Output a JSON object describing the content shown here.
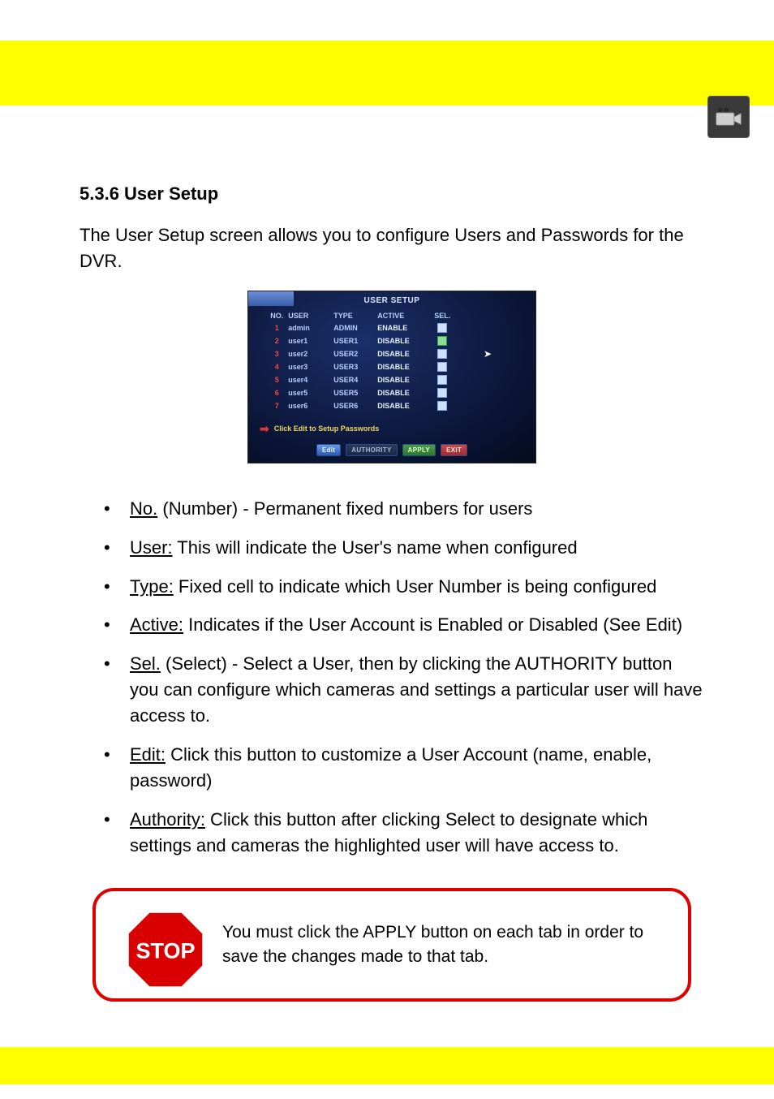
{
  "header": {
    "icon_name": "camera-icon"
  },
  "section": {
    "title": "5.3.6 User Setup",
    "intro": "The User Setup screen allows you to configure Users and Passwords for the DVR."
  },
  "dvr": {
    "title": "USER SETUP",
    "headers": {
      "no": "NO.",
      "user": "USER",
      "type": "TYPE",
      "active": "ACTIVE",
      "sel": "SEL."
    },
    "rows": [
      {
        "no": "1",
        "user": "admin",
        "type": "ADMIN",
        "active": "ENABLE",
        "sel": false
      },
      {
        "no": "2",
        "user": "user1",
        "type": "USER1",
        "active": "DISABLE",
        "sel": true
      },
      {
        "no": "3",
        "user": "user2",
        "type": "USER2",
        "active": "DISABLE",
        "sel": false
      },
      {
        "no": "4",
        "user": "user3",
        "type": "USER3",
        "active": "DISABLE",
        "sel": false
      },
      {
        "no": "5",
        "user": "user4",
        "type": "USER4",
        "active": "DISABLE",
        "sel": false
      },
      {
        "no": "6",
        "user": "user5",
        "type": "USER5",
        "active": "DISABLE",
        "sel": false
      },
      {
        "no": "7",
        "user": "user6",
        "type": "USER6",
        "active": "DISABLE",
        "sel": false
      }
    ],
    "hint": "Click Edit to Setup Passwords",
    "buttons": {
      "edit": "Edit",
      "authority": "AUTHORITY",
      "apply": "APPLY",
      "exit": "EXIT"
    }
  },
  "bullets": [
    {
      "term": "No.",
      "text": " (Number) - Permanent fixed numbers for users"
    },
    {
      "term": "User:",
      "text": " This will indicate the User's name when configured"
    },
    {
      "term": "Type:",
      "text": " Fixed cell to indicate which User Number is being configured"
    },
    {
      "term": "Active:",
      "text": " Indicates if the User Account is Enabled or Disabled (See Edit)"
    },
    {
      "term": "Sel.",
      "text": " (Select) - Select a User, then by clicking the AUTHORITY button you can configure which cameras and settings a particular user will have access to."
    },
    {
      "term": "Edit:",
      "text": " Click this button to customize a User Account (name, enable, password)"
    },
    {
      "term": "Authority:",
      "text": " Click this button after clicking Select to designate which settings and cameras the highlighted user will have access to."
    }
  ],
  "callout": {
    "text": "You must click the APPLY button on each tab in order to save the changes made to that tab."
  }
}
